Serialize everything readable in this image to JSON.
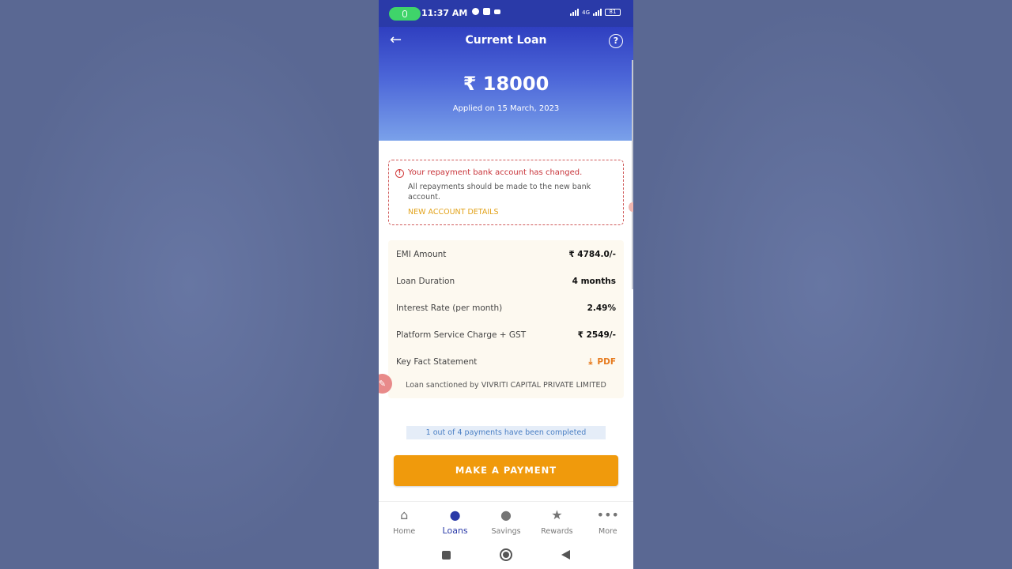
{
  "status_bar": {
    "time": "11:37 AM",
    "network": "4G",
    "battery": "81"
  },
  "header": {
    "title": "Current Loan",
    "amount": "₹ 18000",
    "applied": "Applied on 15 March, 2023",
    "back_icon": "arrow-left-icon",
    "help_icon": "question-circle-icon"
  },
  "alert": {
    "title": "Your repayment bank account has changed.",
    "body": "All repayments should be made to the new bank account.",
    "link": "NEW ACCOUNT DETAILS"
  },
  "details": {
    "rows": [
      {
        "label": "EMI Amount",
        "value": "₹ 4784.0/-"
      },
      {
        "label": "Loan Duration",
        "value": "4 months"
      },
      {
        "label": "Interest Rate (per month)",
        "value": "2.49%"
      },
      {
        "label": "Platform Service Charge + GST",
        "value": "₹ 2549/-"
      },
      {
        "label": "Key Fact Statement",
        "value": "PDF"
      }
    ],
    "sanction": "Loan sanctioned by VIVRITI CAPITAL PRIVATE LIMITED"
  },
  "progress_text": "1 out of 4 payments have been completed",
  "pay_button": "MAKE A PAYMENT",
  "nav": [
    {
      "label": "Home",
      "icon": "home-icon"
    },
    {
      "label": "Loans",
      "icon": "money-bag-icon",
      "active": true
    },
    {
      "label": "Savings",
      "icon": "piggy-bank-icon"
    },
    {
      "label": "Rewards",
      "icon": "star-icon"
    },
    {
      "label": "More",
      "icon": "more-dots-icon"
    }
  ],
  "colors": {
    "header_top": "#2f3fc0",
    "header_bottom": "#7aa1ea",
    "alert_red": "#c8343a",
    "link_gold": "#e2a21a",
    "pay_orange": "#f09a0c",
    "active_nav": "#2a3aa8"
  }
}
